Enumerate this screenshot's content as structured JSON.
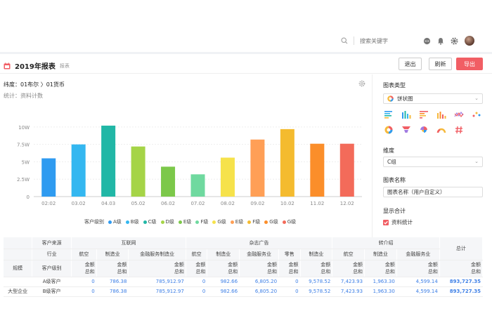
{
  "topbar": {
    "search_placeholder": "搜索关键字",
    "icons": [
      "search-icon",
      "message-icon",
      "bell-icon",
      "gear-icon",
      "avatar"
    ]
  },
  "header": {
    "title": "2019年报表",
    "tag": "报表",
    "buttons": {
      "exit": "退出",
      "refresh": "刷新",
      "export": "导出"
    },
    "colors": {
      "accent": "#f15e64",
      "icon": "#f15e64"
    }
  },
  "chart_panel": {
    "dimension_text": "纬度：01布尔 〉01货币",
    "stat_text": "统计：资料计数"
  },
  "chart_data": {
    "type": "bar",
    "categories": [
      "02:02",
      "03.02",
      "04.03",
      "05.02",
      "06.02",
      "07.02",
      "08.02",
      "09.02",
      "10.02",
      "11.02",
      "12.02"
    ],
    "values": [
      5.5,
      7.5,
      10.2,
      7.2,
      4.3,
      3.2,
      5.6,
      8.2,
      9.7,
      7.6,
      7.6
    ],
    "yticks": [
      "0",
      "2.5W",
      "5W",
      "7.5W",
      "10W"
    ],
    "ylim": [
      0,
      11
    ],
    "colors": [
      "#2f9bf0",
      "#34b7f0",
      "#21b7a6",
      "#a5d447",
      "#7cc84a",
      "#6fd99f",
      "#f6e24b",
      "#ff9f56",
      "#f4bb2f",
      "#fb8e2a",
      "#f36b5a"
    ],
    "legend_title": "客户级别",
    "legend": [
      {
        "name": "A级",
        "color": "#2f9bf0"
      },
      {
        "name": "B级",
        "color": "#34b7f0"
      },
      {
        "name": "C级",
        "color": "#21b7a6"
      },
      {
        "name": "D级",
        "color": "#a5d447"
      },
      {
        "name": "E级",
        "color": "#7cc84a"
      },
      {
        "name": "F级",
        "color": "#6fd99f"
      },
      {
        "name": "G级",
        "color": "#f6e24b"
      },
      {
        "name": "E级",
        "color": "#ff9f56"
      },
      {
        "name": "F级",
        "color": "#f4bb2f"
      },
      {
        "name": "G级",
        "color": "#fb8e2a"
      },
      {
        "name": "G级",
        "color": "#f36b5a"
      }
    ]
  },
  "right_panel": {
    "chart_type_label": "图表类型",
    "chart_type_value": "饼状图",
    "dimension_label": "维度",
    "dimension_value": "C组",
    "chart_name_label": "图表名称",
    "chart_name_value": "图表名称（用户自定义）",
    "total_label": "显示合计",
    "total_checkbox_label": "资料统计",
    "total_checked": true
  },
  "table": {
    "row1": [
      "客户来源",
      "互联网",
      "杂志广告",
      "转介绍",
      "总计"
    ],
    "row2": [
      "行业",
      "航空",
      "制造业",
      "金融服务制造业",
      "航空",
      "制造业",
      "金融服务业",
      "零售",
      "制造业",
      "航空",
      "制造业",
      "金融服务业"
    ],
    "row3_left": [
      "规模",
      "客户级别"
    ],
    "metric_label": "金额总和",
    "rows": [
      {
        "scale": "",
        "level": "A级客户",
        "vals": [
          "0",
          "786.38",
          "785,912.97",
          "0",
          "982.66",
          "6,805.20",
          "0",
          "9,578.52",
          "7,423.93",
          "1,963.30",
          "4,599.14"
        ],
        "total": "893,727.35"
      },
      {
        "scale": "大型企业",
        "level": "B级客户",
        "vals": [
          "0",
          "786.38",
          "785,912.97",
          "0",
          "982.66",
          "6,805.20",
          "0",
          "9,578.52",
          "7,423.93",
          "1,963.30",
          "4,599.14"
        ],
        "total": "893,727.35"
      }
    ]
  }
}
